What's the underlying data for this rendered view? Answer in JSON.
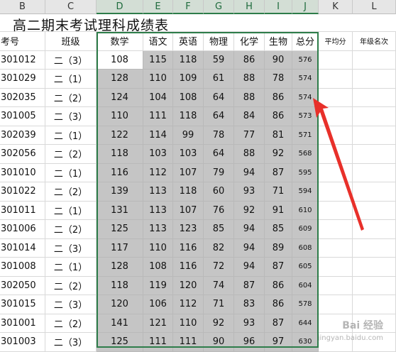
{
  "column_letters": [
    "B",
    "C",
    "D",
    "E",
    "F",
    "G",
    "H",
    "I",
    "J",
    "K",
    "L"
  ],
  "title": "高二期末考试理科成绩表",
  "headers": [
    "考号",
    "班级",
    "数学",
    "语文",
    "英语",
    "物理",
    "化学",
    "生物",
    "总分",
    "平均分",
    "年级名次"
  ],
  "rows": [
    [
      "301012",
      "二（3）",
      "108",
      "115",
      "118",
      "59",
      "86",
      "90",
      "576"
    ],
    [
      "301029",
      "二（1）",
      "128",
      "110",
      "109",
      "61",
      "88",
      "78",
      "574"
    ],
    [
      "302035",
      "二（2）",
      "124",
      "104",
      "108",
      "64",
      "88",
      "86",
      "574"
    ],
    [
      "301005",
      "二（3）",
      "110",
      "111",
      "118",
      "64",
      "84",
      "86",
      "573"
    ],
    [
      "302039",
      "二（1）",
      "122",
      "114",
      "99",
      "78",
      "77",
      "81",
      "571"
    ],
    [
      "302056",
      "二（2）",
      "118",
      "103",
      "103",
      "64",
      "88",
      "92",
      "568"
    ],
    [
      "301010",
      "二（1）",
      "116",
      "112",
      "107",
      "79",
      "94",
      "87",
      "595"
    ],
    [
      "301022",
      "二（2）",
      "139",
      "113",
      "118",
      "60",
      "93",
      "71",
      "594"
    ],
    [
      "301011",
      "二（1）",
      "131",
      "113",
      "107",
      "76",
      "92",
      "91",
      "610"
    ],
    [
      "301006",
      "二（2）",
      "125",
      "113",
      "123",
      "85",
      "94",
      "85",
      "609"
    ],
    [
      "301014",
      "二（3）",
      "117",
      "110",
      "116",
      "82",
      "94",
      "89",
      "608"
    ],
    [
      "301008",
      "二（1）",
      "128",
      "108",
      "116",
      "72",
      "94",
      "87",
      "605"
    ],
    [
      "302050",
      "二（2）",
      "118",
      "119",
      "120",
      "74",
      "87",
      "86",
      "604"
    ],
    [
      "301015",
      "二（3）",
      "120",
      "106",
      "112",
      "71",
      "83",
      "86",
      "578"
    ],
    [
      "301001",
      "二（2）",
      "141",
      "121",
      "110",
      "92",
      "93",
      "87",
      "644"
    ],
    [
      "301003",
      "二（3）",
      "125",
      "111",
      "111",
      "90",
      "96",
      "97",
      "630"
    ]
  ],
  "watermark": "Bai 经验",
  "watermark_sub": "jingyan.baidu.com",
  "colors": {
    "selection_border": "#2e7d4a",
    "selection_fill": "#c5c5c5",
    "arrow": "#e8302a"
  }
}
